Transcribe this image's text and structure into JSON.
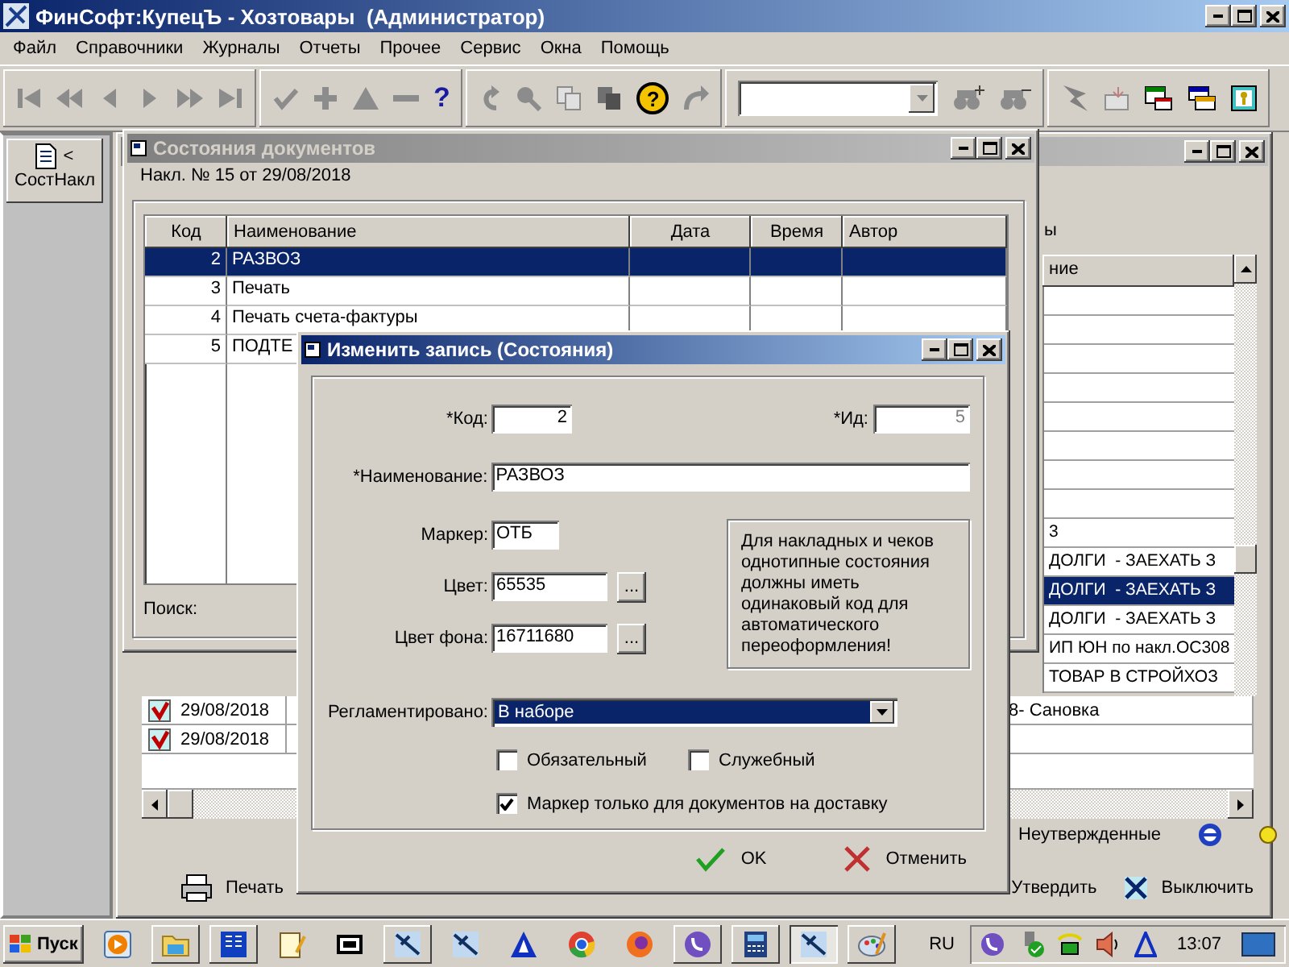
{
  "window": {
    "title": "ФинСофт:КупецЪ - Хозтовары  (Администратор)"
  },
  "menu": [
    "Файл",
    "Справочники",
    "Журналы",
    "Отчеты",
    "Прочее",
    "Сервис",
    "Окна",
    "Помощь"
  ],
  "toolbar": {
    "help_glyphs": [
      "?",
      "?"
    ]
  },
  "side_panel": {
    "tabs": [
      {
        "label": "СостНакл",
        "arrow": "<",
        "selected": true
      }
    ]
  },
  "background_window": {
    "caption": "ы",
    "grid_header": "ние",
    "grid_rows": [
      {
        "text": "3",
        "selected": false
      },
      {
        "text": "ДОЛГИ  - ЗАЕХАТЬ З",
        "selected": false
      },
      {
        "text": "ДОЛГИ  - ЗАЕХАТЬ З",
        "selected": true
      },
      {
        "text": "ДОЛГИ  - ЗАЕХАТЬ З",
        "selected": false
      },
      {
        "text": "ИП ЮН по накл.ОС308",
        "selected": false
      },
      {
        "text": "ТОВАР В СТРОЙХОЗ",
        "selected": false
      }
    ],
    "lower_rows": [
      {
        "date": "29/08/2018",
        "text": "8- Сановка"
      },
      {
        "date": "29/08/2018"
      }
    ],
    "legend": "Неутвержденные",
    "actions": [
      {
        "label": "Печать",
        "kind": "print"
      },
      {
        "label": "Утвердить",
        "kind": "approve"
      },
      {
        "label": "Выключить",
        "kind": "disable"
      }
    ]
  },
  "documents_window": {
    "title": "Состояния документов",
    "subtitle": "Накл. № 15 от 29/08/2018",
    "columns": [
      "Код",
      "Наименование",
      "Дата",
      "Время",
      "Автор"
    ],
    "rows": [
      {
        "code": "2",
        "name": "РАЗВОЗ",
        "selected": true
      },
      {
        "code": "3",
        "name": "Печать",
        "selected": false
      },
      {
        "code": "4",
        "name": "Печать счета-фактуры",
        "selected": false
      },
      {
        "code": "5",
        "name": "ПОДТЕ",
        "selected": false
      }
    ],
    "search_label": "Поиск:"
  },
  "dialog": {
    "title": "Изменить запись (Состояния)",
    "code": {
      "label": "*Код:",
      "value": "2"
    },
    "id": {
      "label": "*Ид:",
      "value": "5",
      "disabled": true
    },
    "name": {
      "label": "*Наименование:",
      "value": "РАЗВОЗ"
    },
    "marker": {
      "label": "Маркер:",
      "value": "ОТБ"
    },
    "color": {
      "label": "Цвет:",
      "value": "65535",
      "button": "..."
    },
    "bg_color": {
      "label": "Цвет фона:",
      "value": "16711680",
      "button": "..."
    },
    "note": "Для накладных и чеков однотипные состояния должны иметь одинаковый код для автоматического переоформления!",
    "regulated": {
      "label": "Регламентировано:",
      "value": "В наборе"
    },
    "checkboxes": [
      {
        "label": "Обязательный",
        "checked": false
      },
      {
        "label": "Служебный",
        "checked": false
      },
      {
        "label": "Маркер только для документов на доставку",
        "checked": true
      }
    ],
    "buttons": [
      {
        "label": "OK",
        "kind": "ok"
      },
      {
        "label": "Отменить",
        "kind": "cancel"
      }
    ]
  },
  "taskbar": {
    "start": "Пуск",
    "language": "RU",
    "clock": "13:07"
  }
}
